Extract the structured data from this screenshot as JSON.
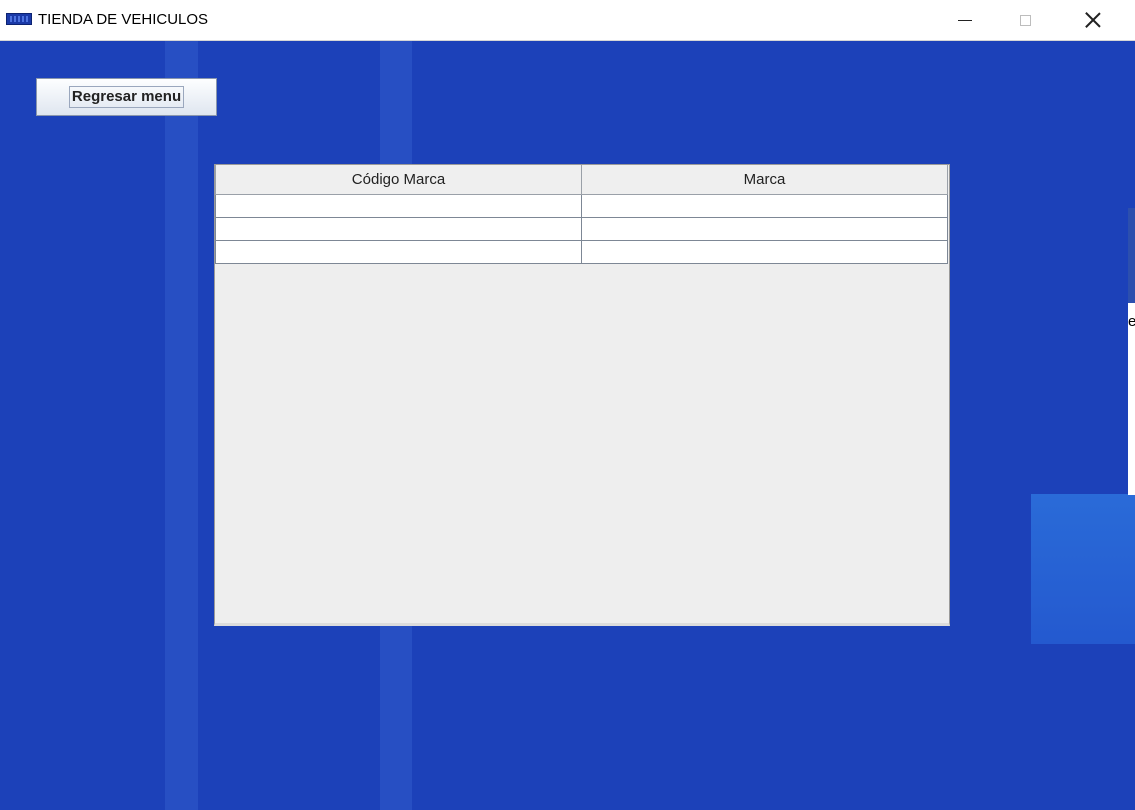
{
  "window": {
    "title": "TIENDA DE VEHICULOS"
  },
  "toolbar": {
    "back_label": "Regresar menu"
  },
  "table": {
    "columns": [
      "Código Marca",
      "Marca"
    ],
    "rows": [
      [
        "",
        ""
      ],
      [
        "",
        ""
      ],
      [
        "",
        ""
      ]
    ]
  },
  "background": {
    "partial_text": "e"
  }
}
